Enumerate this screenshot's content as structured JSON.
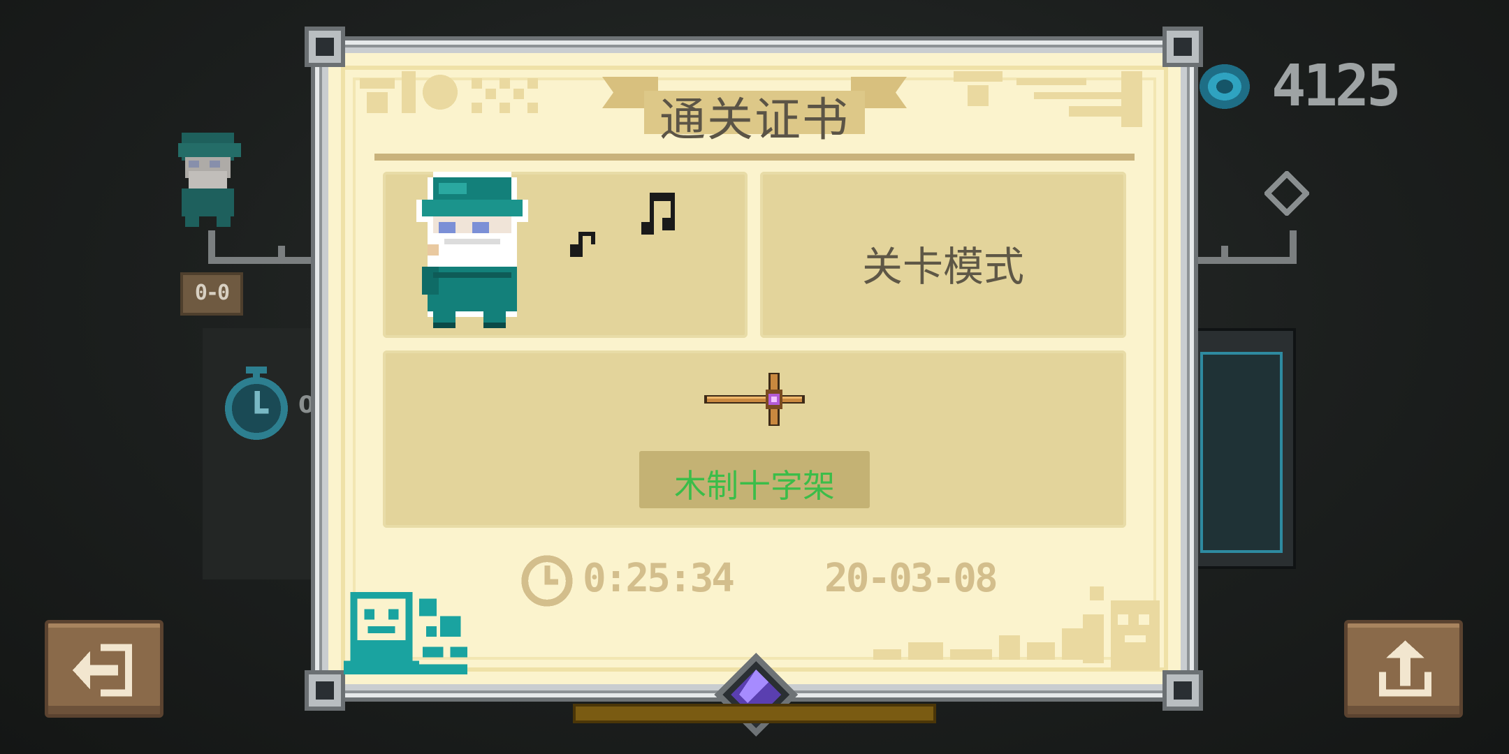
{
  "certificate": {
    "title": "通关证书",
    "mode": "关卡模式",
    "weapon_name": "木制十字架",
    "clear_time": "0:25:34",
    "date": "20-03-08"
  },
  "hud": {
    "gem_count": "4125",
    "stopwatch_value": "0",
    "key_label": "0-0"
  },
  "icons": {
    "exit": "exit-icon",
    "share": "share-icon",
    "gem": "gem-icon",
    "clock": "clock-icon",
    "weapon": "wooden-cross-icon",
    "music": "music-notes-icon"
  },
  "colors": {
    "paper": "#fbf3cd",
    "cell": "#e3d49b",
    "weapon_label": "#3bbd49",
    "hero_teal": "#13807a",
    "button_brown": "#8a6a4a"
  }
}
